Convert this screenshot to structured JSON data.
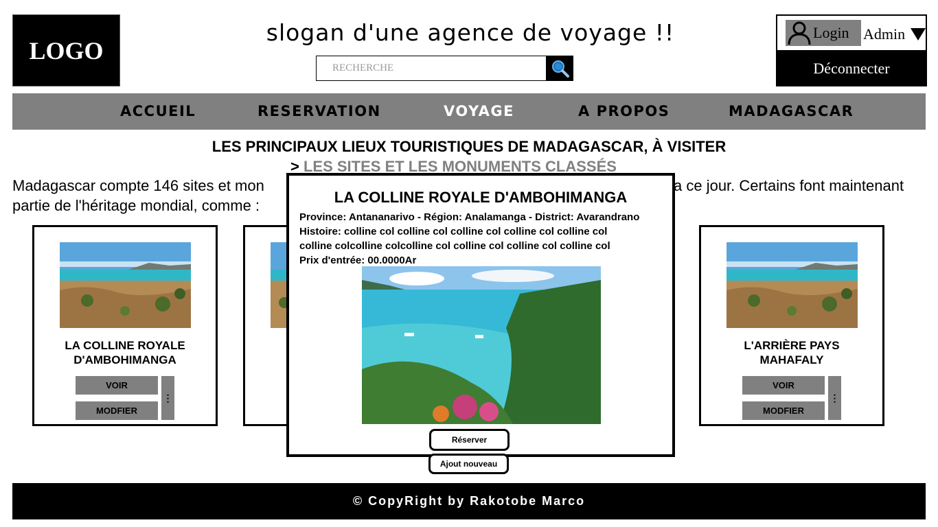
{
  "header": {
    "logo": "LOGO",
    "slogan": "slogan d'une agence de voyage !!",
    "search_placeholder": "RECHERCHE",
    "login_label": "Login",
    "user_name": "Admin",
    "logout_label": "Déconnecter"
  },
  "nav": {
    "items": [
      "ACCUEIL",
      "RESERVATION",
      "VOYAGE",
      "A PROPOS",
      "MADAGASCAR"
    ],
    "active": "VOYAGE"
  },
  "main": {
    "title": "LES PRINCIPAUX LIEUX TOURISTIQUES DE MADAGASCAR, À VISITER",
    "crumb_sep": ">",
    "crumb_link": "LES SITES ET LES MONUMENTS CLASSÉS",
    "intro_line1_left": "Madagascar compte 146 sites et mon",
    "intro_line1_right": "a ce jour. Certains font maintenant",
    "intro_line2": "partie de l'héritage mondial, comme :"
  },
  "cards": [
    {
      "title_l1": "LA COLLINE ROYALE",
      "title_l2": "D'AMBOHIMANGA",
      "view_label": "VOIR",
      "edit_label": "MODFIER",
      "more_label": "⋮"
    },
    {
      "title_l1": "",
      "title_l2": "",
      "view_label": "",
      "edit_label": "",
      "more_label": ""
    },
    {
      "title_l1": "L'ARRIÈRE PAYS",
      "title_l2": "MAHAFALY",
      "view_label": "VOIR",
      "edit_label": "MODFIER",
      "more_label": "⋮"
    }
  ],
  "modal": {
    "title": "LA COLLINE ROYALE D'AMBOHIMANGA",
    "location": "Province: Antananarivo - Région: Analamanga - District: Avarandrano",
    "history_l1": "Histoire: colline col colline col colline col colline col colline col",
    "history_l2": "colline colcolline colcolline col colline col colline col colline col",
    "price": "Prix d'entrée: 00.0000Ar",
    "reserve_label": "Réserver"
  },
  "add_new_label": "Ajout nouveau",
  "footer": {
    "copyright": "© CopyRight by Rakotobe Marco"
  },
  "colors": {
    "nav_bg": "#808080",
    "black": "#000000",
    "button_grey": "#808080",
    "active_nav": "#ffffff"
  }
}
